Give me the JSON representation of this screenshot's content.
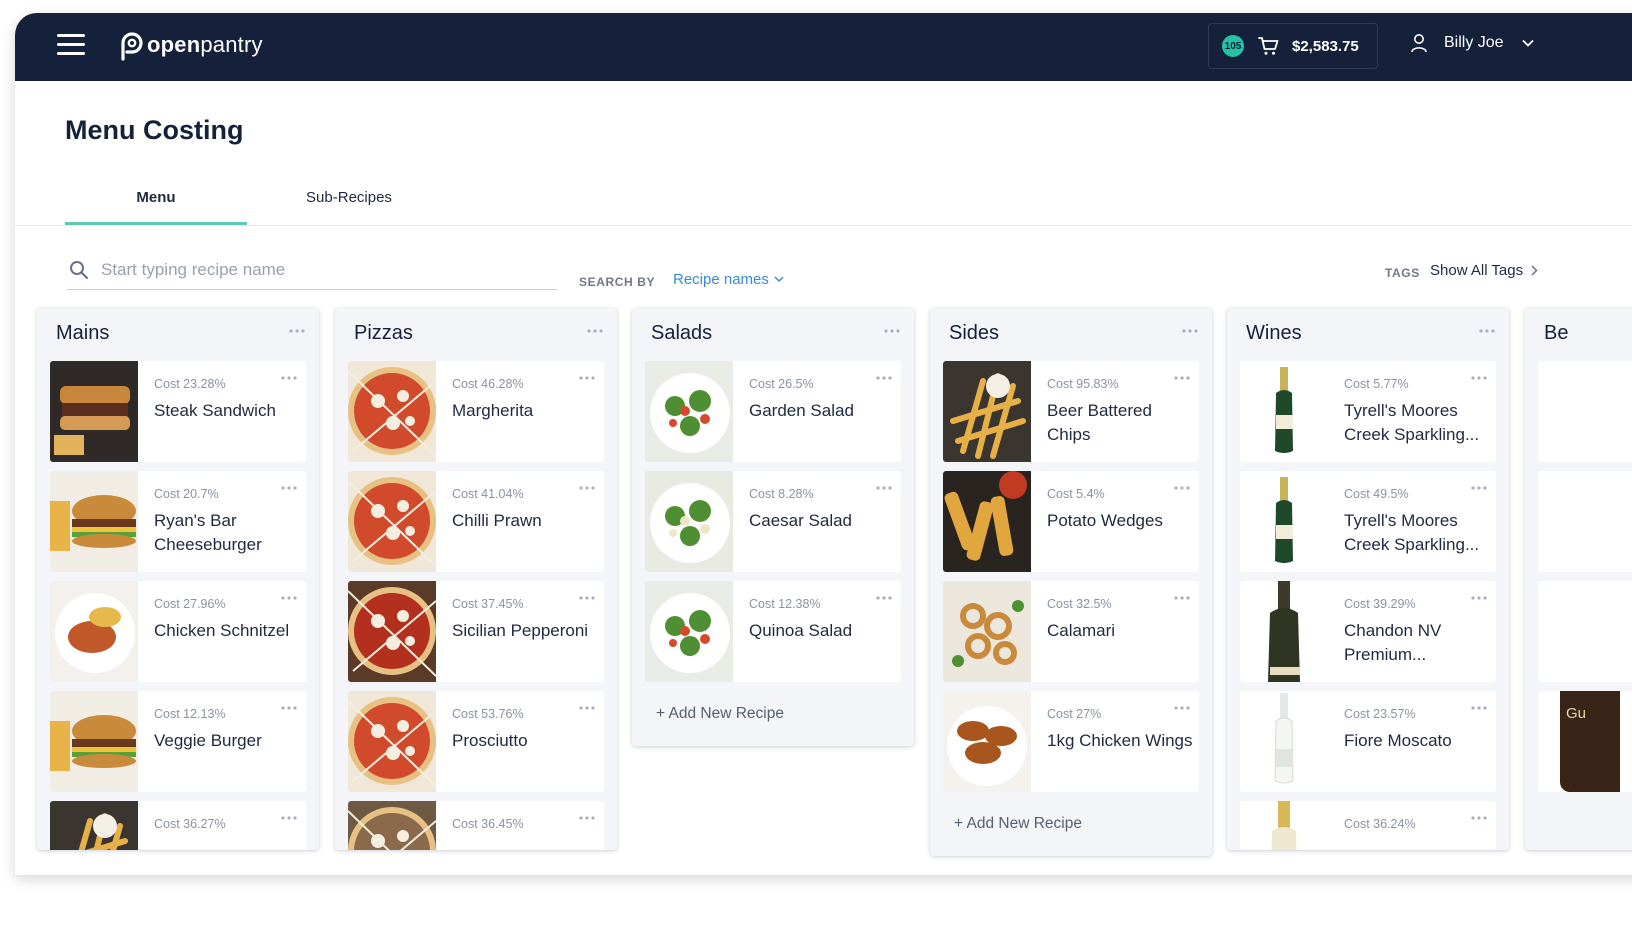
{
  "header": {
    "logo_text_bold": "open",
    "logo_text_rest": "pantry",
    "cart_badge": "105",
    "cart_total": "$2,583.75",
    "user_name": "Billy Joe"
  },
  "page": {
    "title": "Menu Costing",
    "tabs": [
      {
        "label": "Menu",
        "active": true
      },
      {
        "label": "Sub-Recipes",
        "active": false
      }
    ]
  },
  "search": {
    "placeholder": "Start typing recipe name",
    "search_by_label": "SEARCH BY",
    "search_by_value": "Recipe names",
    "tags_label": "TAGS",
    "tags_value": "Show All Tags"
  },
  "columns": [
    {
      "title": "Mains",
      "add_label": "",
      "recipes": [
        {
          "cost": "Cost 23.28%",
          "name": "Steak Sandwich",
          "image": "steak-sandwich"
        },
        {
          "cost": "Cost 20.7%",
          "name": "Ryan's Bar Cheeseburger",
          "image": "burger"
        },
        {
          "cost": "Cost 27.96%",
          "name": "Chicken Schnitzel",
          "image": "schnitzel"
        },
        {
          "cost": "Cost 12.13%",
          "name": "Veggie Burger",
          "image": "burger"
        },
        {
          "cost": "Cost 36.27%",
          "name": "",
          "image": "fries"
        }
      ]
    },
    {
      "title": "Pizzas",
      "add_label": "",
      "recipes": [
        {
          "cost": "Cost 46.28%",
          "name": "Margherita",
          "image": "pizza"
        },
        {
          "cost": "Cost 41.04%",
          "name": "Chilli Prawn",
          "image": "pizza"
        },
        {
          "cost": "Cost 37.45%",
          "name": "Sicilian Pepperoni",
          "image": "pepperoni"
        },
        {
          "cost": "Cost 53.76%",
          "name": "Prosciutto",
          "image": "pizza"
        },
        {
          "cost": "Cost 36.45%",
          "name": "",
          "image": "mushroom-pizza"
        }
      ]
    },
    {
      "title": "Salads",
      "add_label": "+ Add New Recipe",
      "recipes": [
        {
          "cost": "Cost 26.5%",
          "name": "Garden Salad",
          "image": "salad"
        },
        {
          "cost": "Cost 8.28%",
          "name": "Caesar Salad",
          "image": "caesar"
        },
        {
          "cost": "Cost 12.38%",
          "name": "Quinoa Salad",
          "image": "salad"
        }
      ]
    },
    {
      "title": "Sides",
      "add_label": "+ Add New Recipe",
      "recipes": [
        {
          "cost": "Cost 95.83%",
          "name": "Beer Battered Chips",
          "image": "fries"
        },
        {
          "cost": "Cost 5.4%",
          "name": "Potato Wedges",
          "image": "wedges"
        },
        {
          "cost": "Cost 32.5%",
          "name": "Calamari",
          "image": "calamari"
        },
        {
          "cost": "Cost 27%",
          "name": "1kg Chicken Wings",
          "image": "wings"
        }
      ]
    },
    {
      "title": "Wines",
      "add_label": "",
      "recipes": [
        {
          "cost": "Cost 5.77%",
          "name": "Tyrell's Moores Creek Sparkling...",
          "image": "green-bottle"
        },
        {
          "cost": "Cost 49.5%",
          "name": "Tyrell's Moores Creek Sparkling...",
          "image": "green-bottle"
        },
        {
          "cost": "Cost 39.29%",
          "name": "Chandon NV Premium...",
          "image": "dark-bottle"
        },
        {
          "cost": "Cost 23.57%",
          "name": "Fiore Moscato",
          "image": "white-bottle"
        },
        {
          "cost": "Cost 36.24%",
          "name": "",
          "image": "champagne-bottle"
        }
      ]
    }
  ],
  "partial_column": {
    "title": "Be",
    "card_text": "Gu"
  },
  "colors": {
    "navbar": "#15213a",
    "accent_teal": "#5ec7b6",
    "badge": "#25c2a8",
    "link_blue": "#3a8ad8",
    "column_bg": "#f3f5f8"
  },
  "icons": [
    "menu-icon",
    "openpantry-logo-icon",
    "cart-icon",
    "user-icon",
    "chevron-down-icon",
    "search-icon",
    "chevron-right-icon",
    "more-dots-icon"
  ]
}
